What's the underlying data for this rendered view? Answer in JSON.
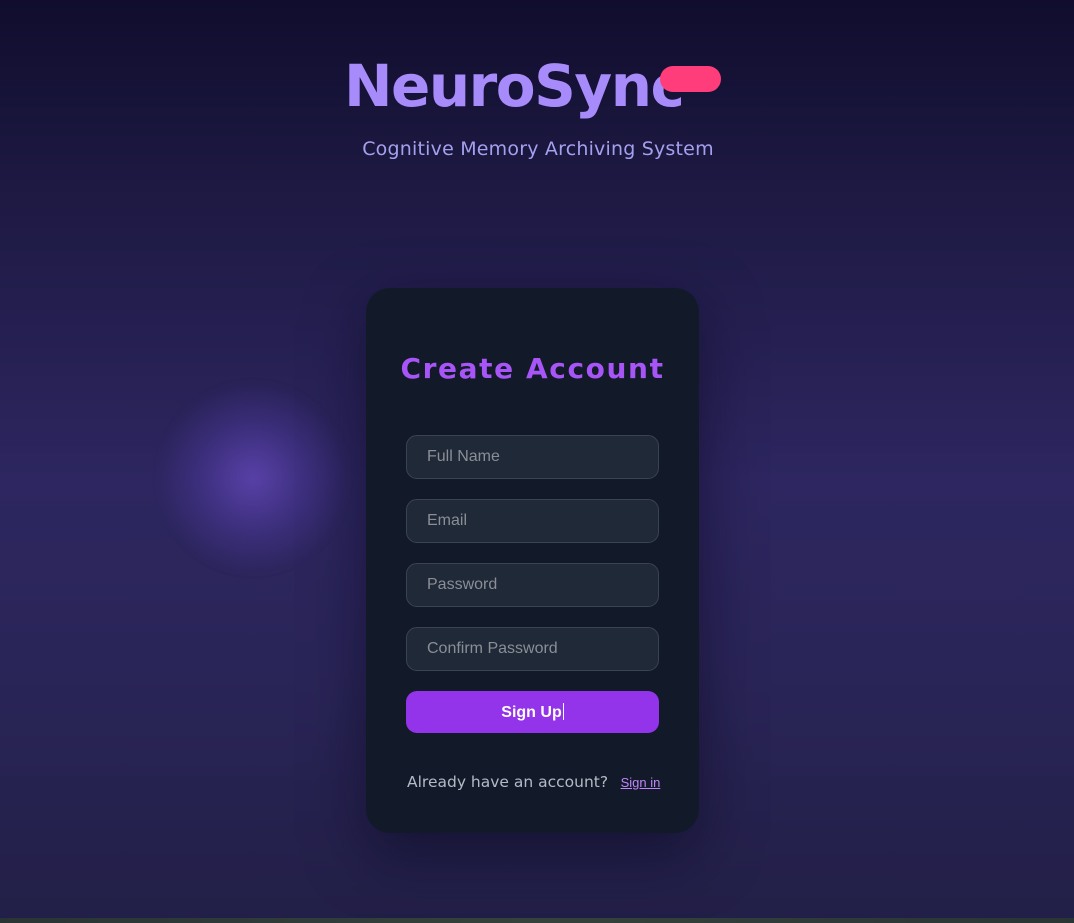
{
  "header": {
    "title": "NeuroSync",
    "subtitle": "Cognitive Memory Archiving System"
  },
  "form": {
    "title": "Create Account",
    "fields": [
      {
        "placeholder": "Full Name",
        "value": ""
      },
      {
        "placeholder": "Email",
        "value": ""
      },
      {
        "placeholder": "Password",
        "value": ""
      },
      {
        "placeholder": "Confirm Password",
        "value": ""
      }
    ],
    "submit_label": "Sign Up",
    "footer_text": "Already have an account?",
    "signin_link": "Sign in"
  },
  "colors": {
    "brand": "#a78bfa",
    "accent_pill": "#ff3d7a",
    "button": "#9333ea",
    "card": "#121a29",
    "link": "#c084fc"
  }
}
